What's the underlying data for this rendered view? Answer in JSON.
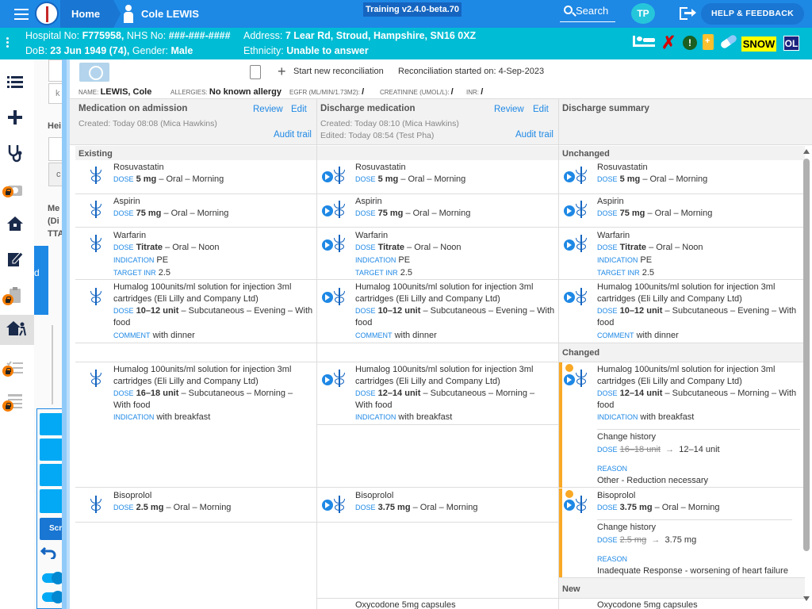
{
  "topbar": {
    "home_label": "Home",
    "patient_name": "Cole LEWIS",
    "version": "Training v2.4.0-beta.70",
    "search_label": "Search",
    "avatar_initials": "TP",
    "help_label": "HELP & FEEDBACK"
  },
  "banner": {
    "hospital_no_label": "Hospital No:",
    "hospital_no": "F775958,",
    "nhs_no_label": "NHS No:",
    "nhs_no": "###-###-####",
    "address_label": "Address:",
    "address": "7 Lear Rd, Stroud, Hampshire, SN16 0XZ",
    "dob_label": "DoB:",
    "dob": "23 Jun 1949 (74),",
    "gender_label": "Gender:",
    "gender": "Male",
    "ethnicity_label": "Ethnicity:",
    "ethnicity": "Unable to answer",
    "snow_badge": "SNOW",
    "ol_badge": "OL"
  },
  "background_panel": {
    "k_label": "k",
    "hei_label": "Hei",
    "c_label": "c",
    "me_label": "Me",
    "dis_label": "(Di",
    "tta_label": "TTA",
    "d_label": "d",
    "scr_label": "Scr"
  },
  "toolbar": {
    "new_reconciliation": "Start new reconciliation",
    "started": "Reconciliation started on: 4-Sep-2023"
  },
  "infobar": {
    "name_label": "NAME:",
    "name_value": "LEWIS, Cole",
    "allergies_label": "ALLERGIES:",
    "allergies_value": "No known allergy",
    "egfr_label": "EGFR (ML/MIN/1.73M2):",
    "egfr_value": "/",
    "creatinine_label": "CREATININE (UMOL/L):",
    "creatinine_value": "/",
    "inr_label": "INR:",
    "inr_value": "/"
  },
  "columns": {
    "admission": {
      "title": "Medication on admission",
      "review": "Review",
      "edit": "Edit",
      "created": "Created: Today 08:08 (Mica Hawkins)",
      "audit": "Audit trail"
    },
    "discharge": {
      "title": "Discharge medication",
      "review": "Review",
      "edit": "Edit",
      "created": "Created: Today 08:10 (Mica Hawkins)",
      "edited": "Edited: Today 08:54 (Test Pha)",
      "audit": "Audit trail"
    },
    "summary": {
      "title": "Discharge summary"
    }
  },
  "sections": {
    "existing": "Existing",
    "unchanged": "Unchanged",
    "changed": "Changed",
    "new": "New"
  },
  "labels": {
    "dose": "DOSE",
    "indication": "INDICATION",
    "target_inr": "TARGET INR",
    "comment": "COMMENT",
    "reason": "REASON",
    "change_history": "Change history"
  },
  "meds": {
    "rosuvastatin": {
      "name": "Rosuvastatin",
      "dose": "5 mg",
      "route": "– Oral – Morning"
    },
    "aspirin": {
      "name": "Aspirin",
      "dose": "75 mg",
      "route": "– Oral – Morning"
    },
    "warfarin": {
      "name": "Warfarin",
      "dose": "Titrate",
      "route": "– Oral – Noon",
      "indication": "PE",
      "target_inr": "2.5"
    },
    "humalog_evening": {
      "name": "Humalog 100units/ml solution for injection 3ml cartridges (Eli Lilly and Company Ltd)",
      "dose": "10–12 unit",
      "route": "– Subcutaneous – Evening – With food",
      "comment": "with dinner"
    },
    "humalog_morning_adm": {
      "name": "Humalog 100units/ml solution for injection 3ml cartridges (Eli Lilly and Company Ltd)",
      "dose": "16–18 unit",
      "route": "– Subcutaneous – Morning – With food",
      "indication": "with breakfast"
    },
    "humalog_morning_dis": {
      "name": "Humalog 100units/ml solution for injection 3ml cartridges (Eli Lilly and Company Ltd)",
      "dose": "12–14 unit",
      "route": "– Subcutaneous – Morning – With food",
      "indication": "with breakfast",
      "old_dose": "16–18 unit",
      "new_dose": "12–14 unit",
      "reason": "Other - Reduction necessary"
    },
    "bisoprolol_adm": {
      "name": "Bisoprolol",
      "dose": "2.5 mg",
      "route": "– Oral – Morning"
    },
    "bisoprolol_dis": {
      "name": "Bisoprolol",
      "dose": "3.75 mg",
      "route": "– Oral – Morning",
      "old_dose": "2.5 mg",
      "new_dose": "3.75 mg",
      "reason": "Inadequate Response - worsening of heart failure"
    },
    "oxycodone": {
      "name": "Oxycodone 5mg capsules"
    }
  }
}
